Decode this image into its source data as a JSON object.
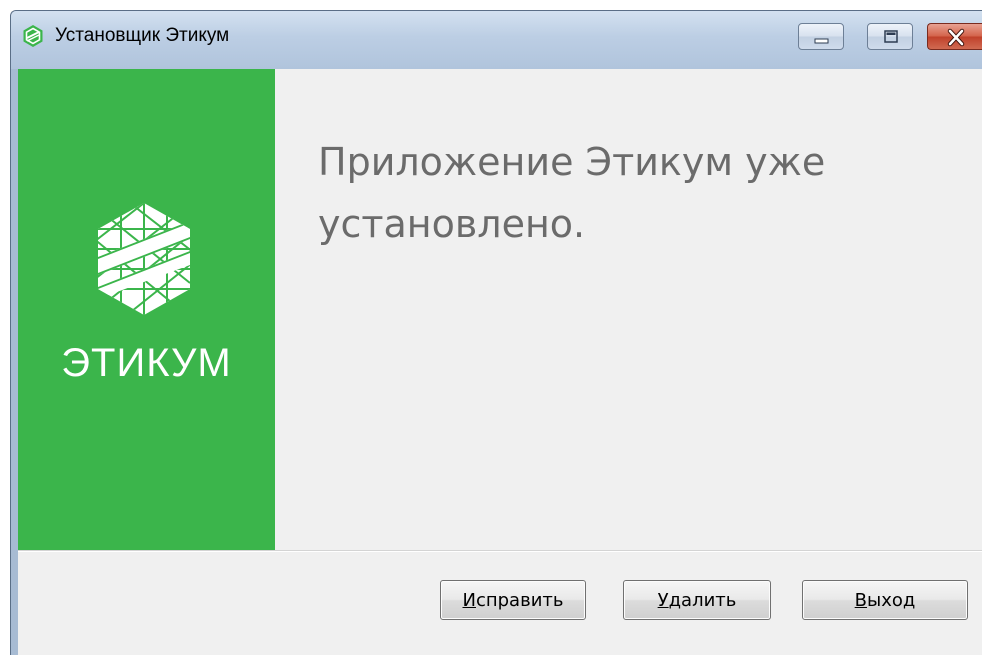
{
  "window": {
    "title": "Установщик Этикум",
    "controls": [
      "minimize",
      "maximize",
      "close"
    ]
  },
  "banner": {
    "logo_text": "ЭТИКУМ",
    "color": "#3bb54b"
  },
  "main": {
    "heading": "Приложение Этикум уже установлено."
  },
  "buttons": {
    "repair": {
      "accel": "И",
      "rest": "справить"
    },
    "remove": {
      "accel": "У",
      "rest": "далить"
    },
    "exit": {
      "accel": "В",
      "rest": "ыход"
    }
  },
  "icons": {
    "app": "etikum-logo-icon",
    "minimize": "minimize-icon",
    "maximize": "maximize-icon",
    "close": "close-icon"
  }
}
